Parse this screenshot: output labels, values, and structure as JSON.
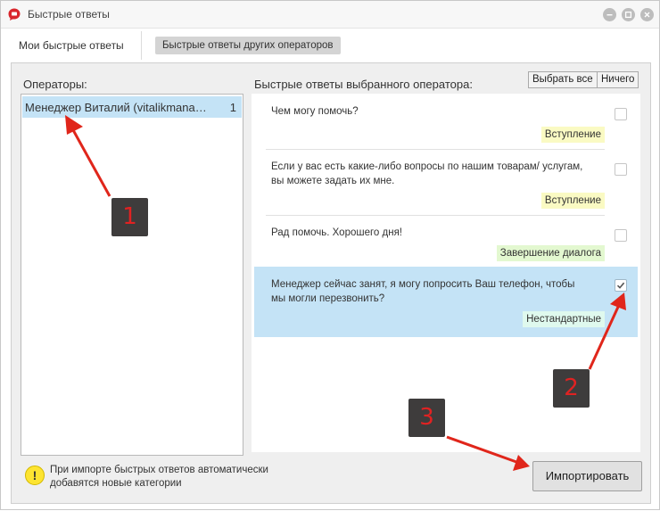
{
  "window": {
    "title": "Быстрые ответы"
  },
  "tabs": {
    "mine": "Мои быстрые ответы",
    "others": "Быстрые ответы других операторов"
  },
  "operators": {
    "label": "Операторы:",
    "items": [
      {
        "name": "Менеджер Виталий (vitalikmana…",
        "count": "1"
      }
    ]
  },
  "answers": {
    "label": "Быстрые ответы выбранного оператора:",
    "select_all": "Выбрать все",
    "none": "Ничего",
    "items": [
      {
        "text": "Чем могу помочь?",
        "tag": "Вступление",
        "tag_color": "#fafac3",
        "checked": false
      },
      {
        "text": "Если у вас есть какие-либо вопросы по нашим товарам/ услугам, вы можете задать их мне.",
        "tag": "Вступление",
        "tag_color": "#fafac3",
        "checked": false
      },
      {
        "text": "Рад помочь. Хорошего дня!",
        "tag": "Завершение диалога",
        "tag_color": "#e3f8d0",
        "checked": false
      },
      {
        "text": "Менеджер сейчас занят, я могу попросить Ваш телефон, чтобы мы могли перезвонить?",
        "tag": "Нестандартные",
        "tag_color": "#dff9ee",
        "checked": true
      }
    ]
  },
  "footer": {
    "warning_text": "При импорте быстрых ответов автоматически добавятся новые категории",
    "import_button": "Импортировать"
  },
  "annotations": {
    "badge1": "1",
    "badge2": "2",
    "badge3": "3",
    "arrow_color": "#e0261b"
  },
  "colors": {
    "selection": "#c4e3f6",
    "app_icon": "#d9262c"
  }
}
